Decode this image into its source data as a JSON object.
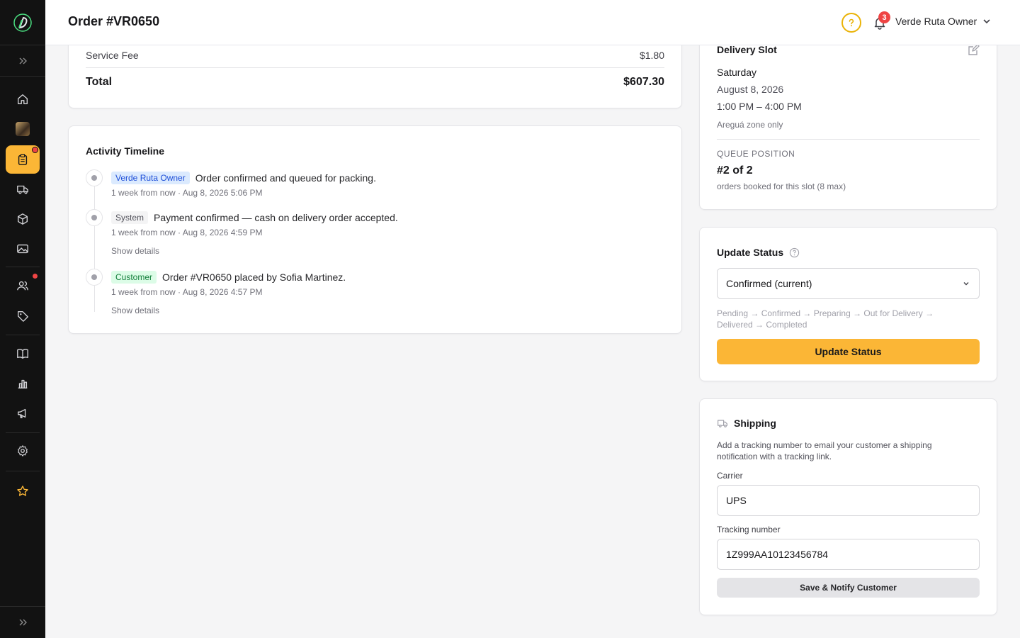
{
  "header": {
    "title": "Order #VR0650",
    "notification_count": "3",
    "user_name": "Verde Ruta Owner"
  },
  "sidebar": {
    "items": [
      {
        "icon": "home-icon",
        "active": false
      },
      {
        "icon": "store-thumbnail",
        "active": false
      },
      {
        "icon": "orders-icon",
        "active": true,
        "badge": true
      },
      {
        "icon": "truck-icon",
        "active": false
      },
      {
        "icon": "box-icon",
        "active": false
      },
      {
        "icon": "image-icon",
        "active": false
      },
      {
        "icon": "users-icon",
        "active": false,
        "badge": true
      },
      {
        "icon": "tag-icon",
        "active": false
      },
      {
        "icon": "book-icon",
        "active": false
      },
      {
        "icon": "chart-icon",
        "active": false
      },
      {
        "icon": "megaphone-icon",
        "active": false
      },
      {
        "icon": "gear-icon",
        "active": false
      },
      {
        "icon": "star-icon",
        "active": false
      }
    ]
  },
  "totals": {
    "service_fee_label": "Service Fee",
    "service_fee_value": "$1.80",
    "total_label": "Total",
    "total_value": "$607.30"
  },
  "timeline": {
    "title": "Activity Timeline",
    "events": [
      {
        "actor": "Verde Ruta Owner",
        "text": "Order confirmed and queued for packing.",
        "meta": "1 week from now · Aug 8, 2026 5:06 PM"
      },
      {
        "actor": "System",
        "text": "Payment confirmed — cash on delivery order accepted.",
        "meta": "1 week from now · Aug 8, 2026 4:59 PM",
        "details": "Show details"
      },
      {
        "actor": "Customer",
        "text": "Order #VR0650 placed by Sofia Martinez.",
        "meta": "1 week from now · Aug 8, 2026 4:57 PM",
        "details": "Show details"
      }
    ]
  },
  "delivery_slot": {
    "title": "Delivery Slot",
    "day": "Saturday",
    "date": "August 8, 2026",
    "time": "1:00 PM – 4:00 PM",
    "zone": "Areguá zone only",
    "queue_label": "QUEUE POSITION",
    "queue_value": "#2 of 2",
    "queue_sub": "orders booked for this slot (8 max)"
  },
  "update_status": {
    "title": "Update Status",
    "selected": "Confirmed (current)",
    "flow": "Pending → Confirmed → Preparing → Out for Delivery → Delivered → Completed",
    "button": "Update Status"
  },
  "shipping": {
    "title": "Shipping",
    "description": "Add a tracking number to email your customer a shipping notification with a tracking link.",
    "carrier_label": "Carrier",
    "carrier_value": "UPS",
    "tracking_label": "Tracking number",
    "tracking_value": "1Z999AA10123456784",
    "button": "Save & Notify Customer"
  },
  "colors": {
    "accent": "#fbb636",
    "sidebar_bg": "#121212",
    "badge": "#ef4444"
  }
}
